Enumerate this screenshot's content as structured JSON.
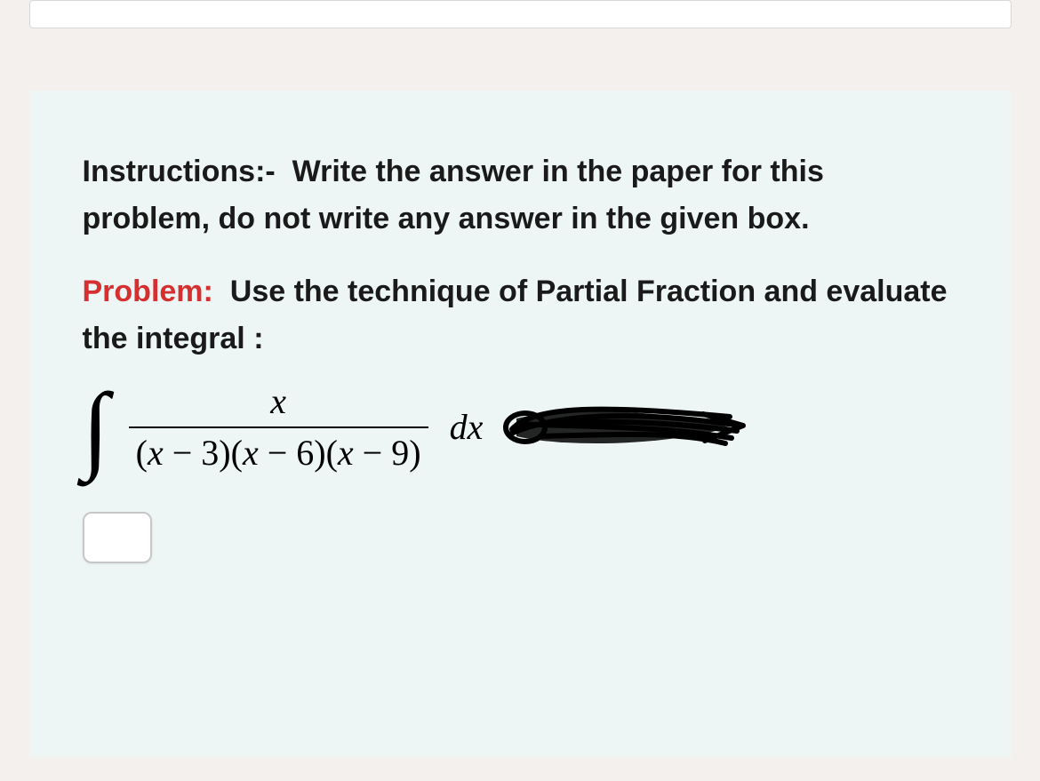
{
  "instructions": {
    "label": "Instructions:-",
    "text": "Write the answer in the paper for this problem, do not write any answer in the given box."
  },
  "problem": {
    "label": "Problem:",
    "text": "Use the technique of Partial Fraction and evaluate the integral :"
  },
  "integral": {
    "numerator": "x",
    "denominator": "(x − 3)(x − 6)(x − 9)",
    "differential": "dx"
  },
  "answer_box": {
    "value": "",
    "placeholder": ""
  }
}
